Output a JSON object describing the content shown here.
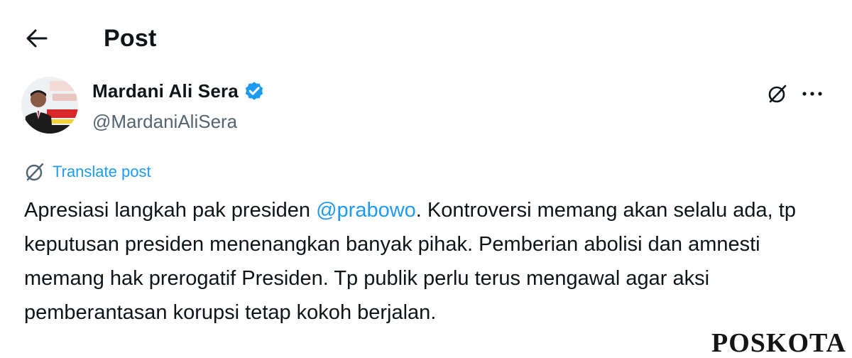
{
  "header": {
    "back_icon": "arrow-left-icon",
    "title": "Post"
  },
  "author": {
    "name": "Mardani Ali Sera",
    "handle": "@MardaniAliSera",
    "verified": true,
    "verified_color": "#1d9bf0",
    "avatar_icon": "avatar-photo"
  },
  "actions": {
    "grok_icon": "grok-icon",
    "more_icon": "more-horizontal-icon"
  },
  "translate": {
    "label": "Translate post",
    "icon": "grok-translate-icon"
  },
  "post": {
    "text_before": "Apresiasi langkah pak presiden ",
    "mention": "@prabowo",
    "text_after": ". Kontroversi memang akan selalu ada, tp keputusan presiden menenangkan banyak pihak. Pemberian abolisi dan amnesti memang hak prerogatif Presiden. Tp publik perlu terus mengawal agar aksi pemberantasan korupsi tetap kokoh berjalan."
  },
  "watermark": {
    "text": "POSKOTA"
  },
  "colors": {
    "text_primary": "#0f1419",
    "text_secondary": "#536471",
    "link": "#1d9bf0"
  }
}
